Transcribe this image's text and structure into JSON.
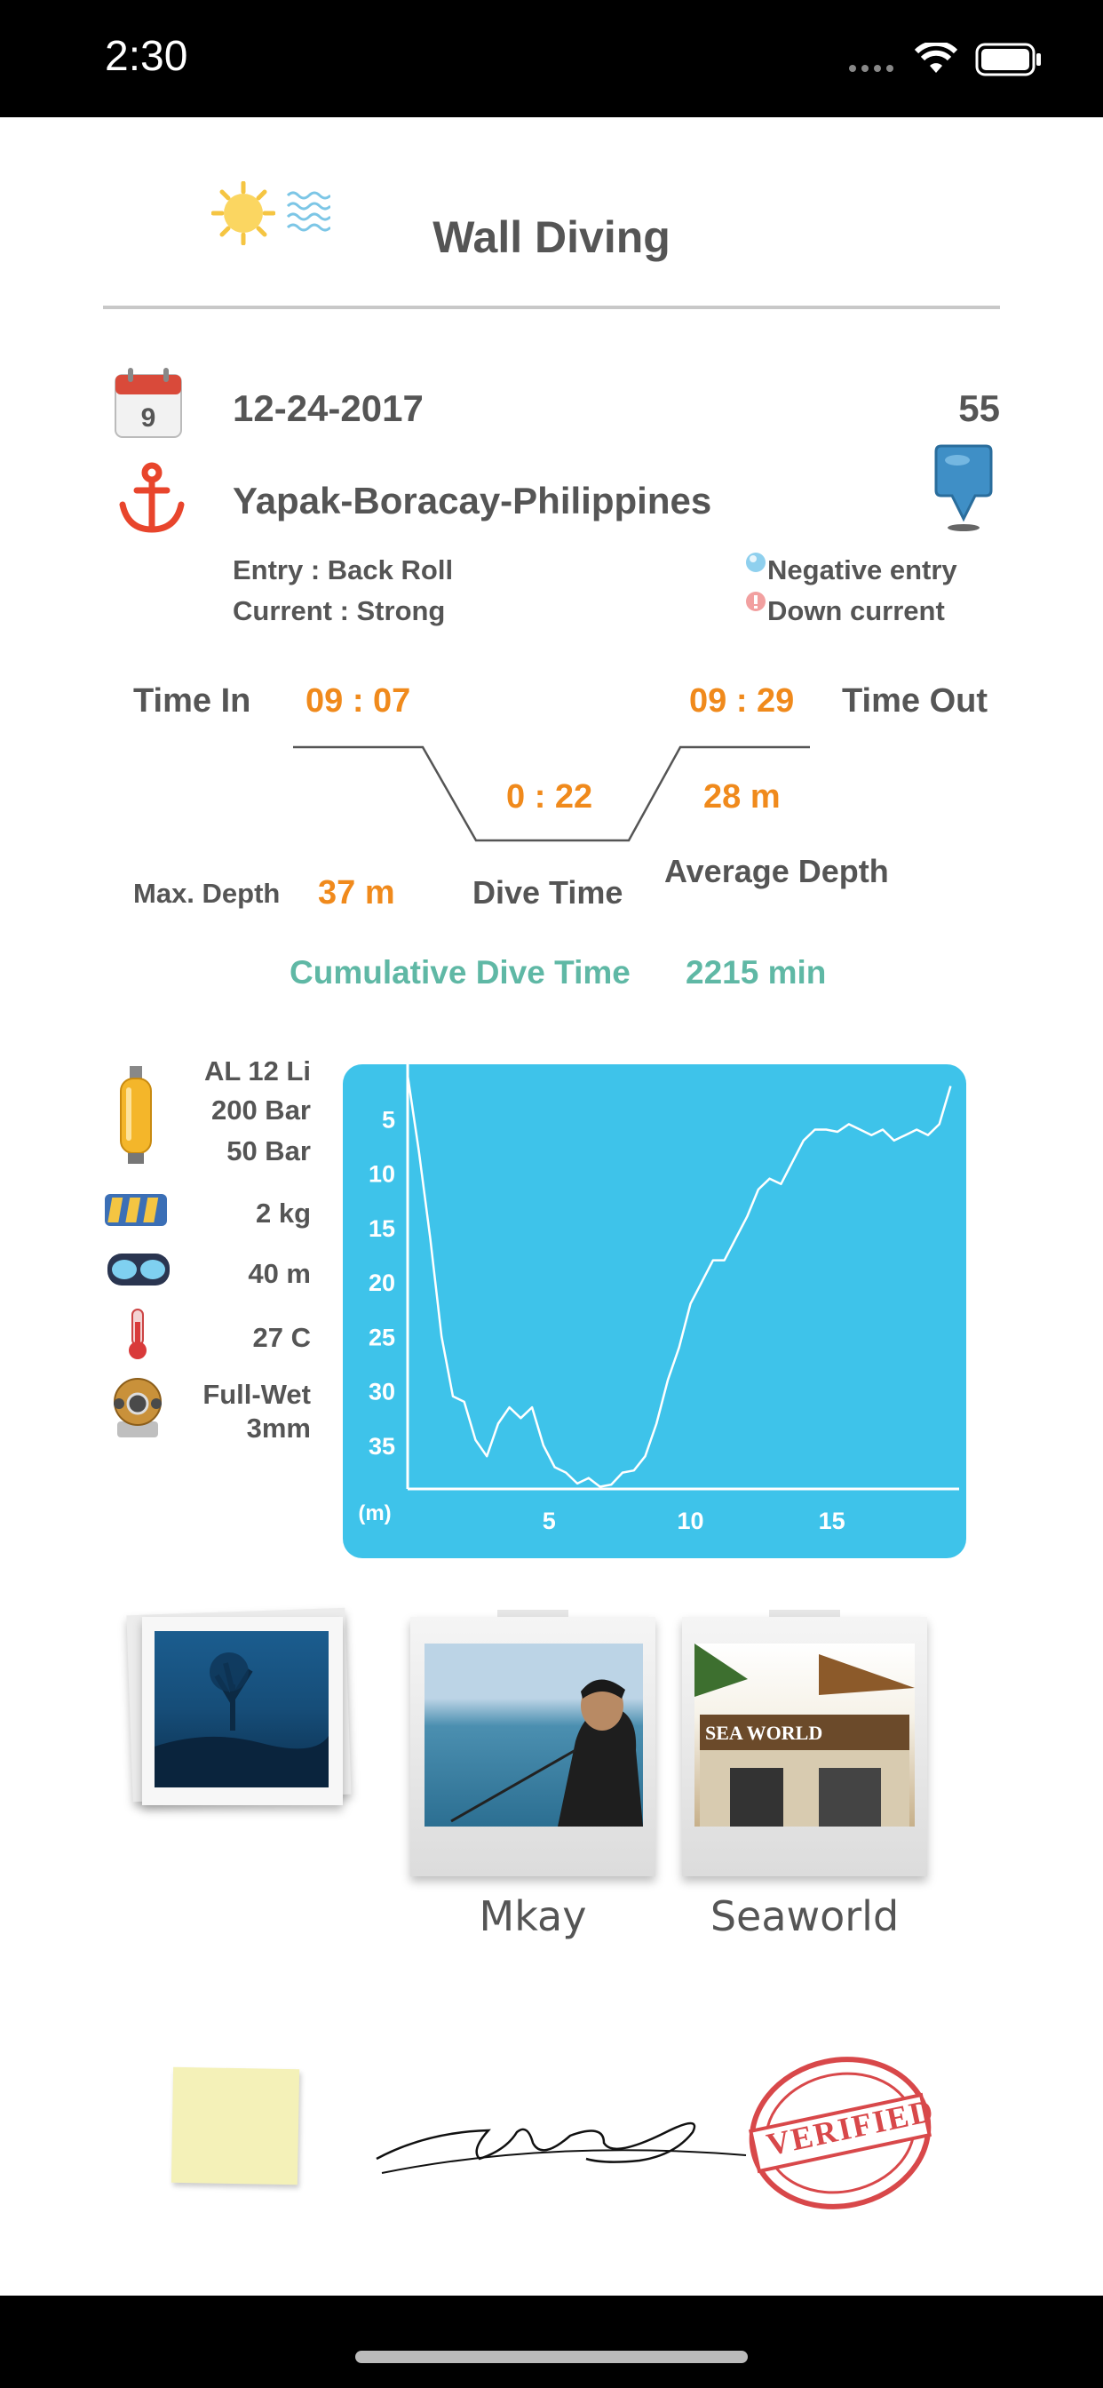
{
  "status_bar": {
    "time": "2:30"
  },
  "header": {
    "title": "Wall Diving",
    "weather_icon": "sun-icon",
    "water_icon": "waves-icon"
  },
  "dive": {
    "date": "12-24-2017",
    "number": "55",
    "location": "Yapak-Boracay-Philippines",
    "entry": "Entry : Back Roll",
    "current": "Current : Strong",
    "entry_tag": "Negative entry",
    "current_tag": "Down current"
  },
  "profile": {
    "time_in_label": "Time In",
    "time_in": "09 : 07",
    "time_out": "09 : 29",
    "time_out_label": "Time Out",
    "dive_time": "0 : 22",
    "dive_time_label": "Dive Time",
    "avg_depth": "28 m",
    "avg_depth_label": "Average Depth",
    "max_depth_label": "Max. Depth",
    "max_depth": "37 m",
    "cumulative_label": "Cumulative Dive Time",
    "cumulative_value": "2215 min"
  },
  "gear": {
    "tank_material": "AL  12 Li",
    "tank_start": "200 Bar",
    "tank_end": "50 Bar",
    "weight": "2 kg",
    "visibility": "40 m",
    "temperature": "27 C",
    "suit_line1": "Full-Wet",
    "suit_line2": "3mm"
  },
  "chart_data": {
    "type": "line",
    "title": "",
    "xlabel": "",
    "ylabel": "(m)",
    "y_inverted": true,
    "xlim": [
      0,
      19.5
    ],
    "ylim": [
      0,
      39
    ],
    "x_ticks": [
      5,
      10,
      15
    ],
    "y_ticks": [
      5,
      10,
      15,
      20,
      25,
      30,
      35
    ],
    "grid": false,
    "colors": {
      "background": "#3ec3ea",
      "line": "#ffffff"
    },
    "x": [
      0,
      0.4,
      0.8,
      1.2,
      1.6,
      2.0,
      2.4,
      2.8,
      3.2,
      3.6,
      4.0,
      4.4,
      4.8,
      5.2,
      5.6,
      6.0,
      6.4,
      6.8,
      7.2,
      7.6,
      8.0,
      8.4,
      8.8,
      9.2,
      9.6,
      10.0,
      10.4,
      10.8,
      11.2,
      11.6,
      12.0,
      12.4,
      12.8,
      13.2,
      13.6,
      14.0,
      14.4,
      14.8,
      15.2,
      15.6,
      16.0,
      16.4,
      16.8,
      17.2,
      17.6,
      18.0,
      18.4,
      18.8,
      19.2
    ],
    "series": [
      {
        "values": [
          1,
          8,
          16,
          25,
          30.5,
          31,
          34.5,
          36,
          33,
          31.5,
          32.5,
          31.5,
          35,
          37,
          37.5,
          38.5,
          38,
          38.8,
          38.6,
          37.5,
          37.3,
          36,
          33,
          29,
          26,
          22,
          20,
          18,
          18,
          16,
          14,
          11.5,
          10.5,
          11,
          9,
          7,
          6,
          6,
          6.2,
          5.5,
          6,
          6.5,
          6,
          7,
          6.5,
          6,
          6.5,
          5.5,
          2
        ]
      }
    ]
  },
  "photos": [
    {
      "caption": ""
    },
    {
      "caption": "Mkay"
    },
    {
      "caption": "Seaworld"
    }
  ],
  "footer": {
    "note_icon": "sticky-note-icon",
    "signature_icon": "signature-icon",
    "stamp_text": "VERIFIED"
  }
}
